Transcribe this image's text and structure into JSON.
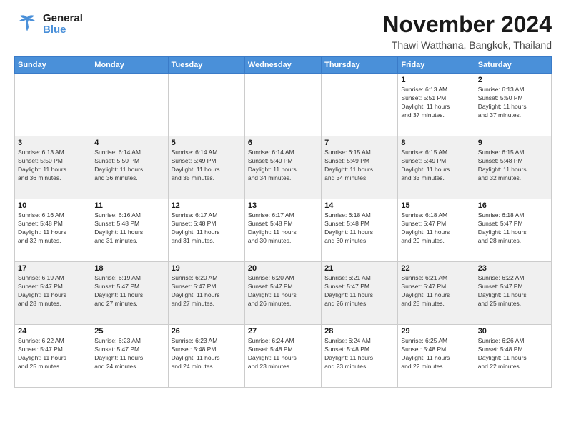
{
  "header": {
    "logo_general": "General",
    "logo_blue": "Blue",
    "month_title": "November 2024",
    "location": "Thawi Watthana, Bangkok, Thailand"
  },
  "days_of_week": [
    "Sunday",
    "Monday",
    "Tuesday",
    "Wednesday",
    "Thursday",
    "Friday",
    "Saturday"
  ],
  "weeks": [
    {
      "id": "week1",
      "cells": [
        {
          "day": "",
          "info": ""
        },
        {
          "day": "",
          "info": ""
        },
        {
          "day": "",
          "info": ""
        },
        {
          "day": "",
          "info": ""
        },
        {
          "day": "",
          "info": ""
        },
        {
          "day": "1",
          "info": "Sunrise: 6:13 AM\nSunset: 5:51 PM\nDaylight: 11 hours\nand 37 minutes."
        },
        {
          "day": "2",
          "info": "Sunrise: 6:13 AM\nSunset: 5:50 PM\nDaylight: 11 hours\nand 37 minutes."
        }
      ]
    },
    {
      "id": "week2",
      "cells": [
        {
          "day": "3",
          "info": "Sunrise: 6:13 AM\nSunset: 5:50 PM\nDaylight: 11 hours\nand 36 minutes."
        },
        {
          "day": "4",
          "info": "Sunrise: 6:14 AM\nSunset: 5:50 PM\nDaylight: 11 hours\nand 36 minutes."
        },
        {
          "day": "5",
          "info": "Sunrise: 6:14 AM\nSunset: 5:49 PM\nDaylight: 11 hours\nand 35 minutes."
        },
        {
          "day": "6",
          "info": "Sunrise: 6:14 AM\nSunset: 5:49 PM\nDaylight: 11 hours\nand 34 minutes."
        },
        {
          "day": "7",
          "info": "Sunrise: 6:15 AM\nSunset: 5:49 PM\nDaylight: 11 hours\nand 34 minutes."
        },
        {
          "day": "8",
          "info": "Sunrise: 6:15 AM\nSunset: 5:49 PM\nDaylight: 11 hours\nand 33 minutes."
        },
        {
          "day": "9",
          "info": "Sunrise: 6:15 AM\nSunset: 5:48 PM\nDaylight: 11 hours\nand 32 minutes."
        }
      ]
    },
    {
      "id": "week3",
      "cells": [
        {
          "day": "10",
          "info": "Sunrise: 6:16 AM\nSunset: 5:48 PM\nDaylight: 11 hours\nand 32 minutes."
        },
        {
          "day": "11",
          "info": "Sunrise: 6:16 AM\nSunset: 5:48 PM\nDaylight: 11 hours\nand 31 minutes."
        },
        {
          "day": "12",
          "info": "Sunrise: 6:17 AM\nSunset: 5:48 PM\nDaylight: 11 hours\nand 31 minutes."
        },
        {
          "day": "13",
          "info": "Sunrise: 6:17 AM\nSunset: 5:48 PM\nDaylight: 11 hours\nand 30 minutes."
        },
        {
          "day": "14",
          "info": "Sunrise: 6:18 AM\nSunset: 5:48 PM\nDaylight: 11 hours\nand 30 minutes."
        },
        {
          "day": "15",
          "info": "Sunrise: 6:18 AM\nSunset: 5:47 PM\nDaylight: 11 hours\nand 29 minutes."
        },
        {
          "day": "16",
          "info": "Sunrise: 6:18 AM\nSunset: 5:47 PM\nDaylight: 11 hours\nand 28 minutes."
        }
      ]
    },
    {
      "id": "week4",
      "cells": [
        {
          "day": "17",
          "info": "Sunrise: 6:19 AM\nSunset: 5:47 PM\nDaylight: 11 hours\nand 28 minutes."
        },
        {
          "day": "18",
          "info": "Sunrise: 6:19 AM\nSunset: 5:47 PM\nDaylight: 11 hours\nand 27 minutes."
        },
        {
          "day": "19",
          "info": "Sunrise: 6:20 AM\nSunset: 5:47 PM\nDaylight: 11 hours\nand 27 minutes."
        },
        {
          "day": "20",
          "info": "Sunrise: 6:20 AM\nSunset: 5:47 PM\nDaylight: 11 hours\nand 26 minutes."
        },
        {
          "day": "21",
          "info": "Sunrise: 6:21 AM\nSunset: 5:47 PM\nDaylight: 11 hours\nand 26 minutes."
        },
        {
          "day": "22",
          "info": "Sunrise: 6:21 AM\nSunset: 5:47 PM\nDaylight: 11 hours\nand 25 minutes."
        },
        {
          "day": "23",
          "info": "Sunrise: 6:22 AM\nSunset: 5:47 PM\nDaylight: 11 hours\nand 25 minutes."
        }
      ]
    },
    {
      "id": "week5",
      "cells": [
        {
          "day": "24",
          "info": "Sunrise: 6:22 AM\nSunset: 5:47 PM\nDaylight: 11 hours\nand 25 minutes."
        },
        {
          "day": "25",
          "info": "Sunrise: 6:23 AM\nSunset: 5:47 PM\nDaylight: 11 hours\nand 24 minutes."
        },
        {
          "day": "26",
          "info": "Sunrise: 6:23 AM\nSunset: 5:48 PM\nDaylight: 11 hours\nand 24 minutes."
        },
        {
          "day": "27",
          "info": "Sunrise: 6:24 AM\nSunset: 5:48 PM\nDaylight: 11 hours\nand 23 minutes."
        },
        {
          "day": "28",
          "info": "Sunrise: 6:24 AM\nSunset: 5:48 PM\nDaylight: 11 hours\nand 23 minutes."
        },
        {
          "day": "29",
          "info": "Sunrise: 6:25 AM\nSunset: 5:48 PM\nDaylight: 11 hours\nand 22 minutes."
        },
        {
          "day": "30",
          "info": "Sunrise: 6:26 AM\nSunset: 5:48 PM\nDaylight: 11 hours\nand 22 minutes."
        }
      ]
    }
  ]
}
